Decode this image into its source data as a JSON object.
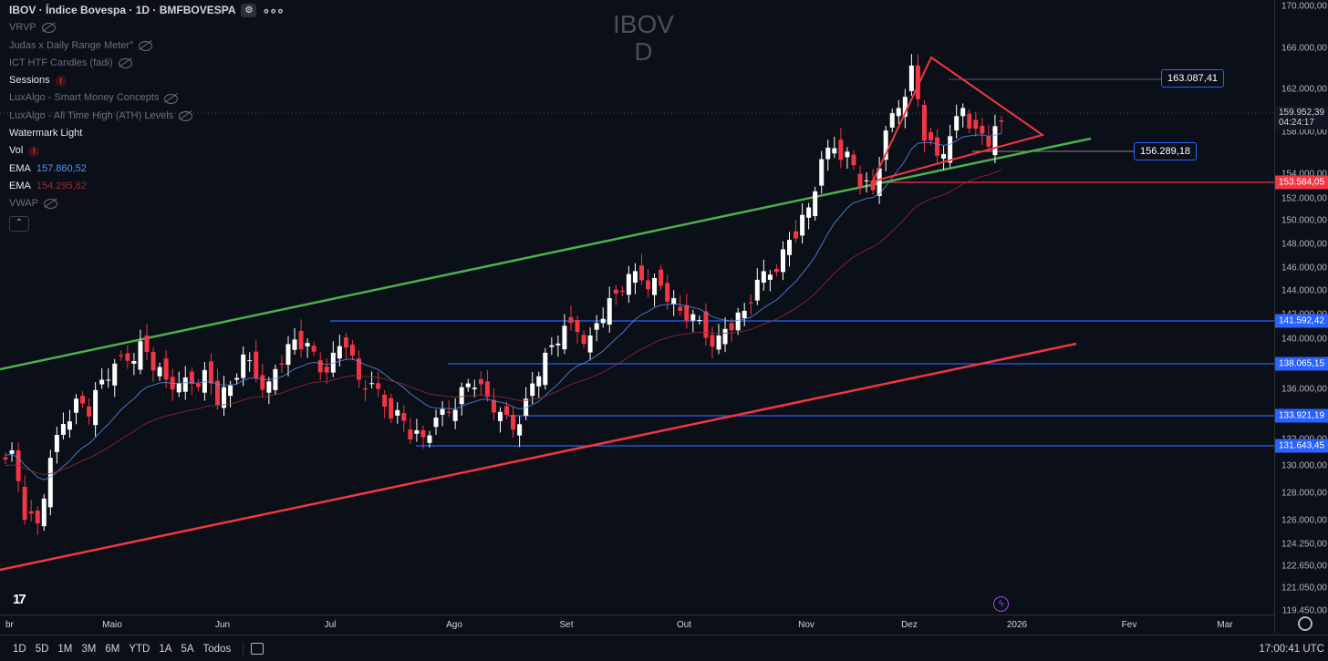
{
  "header": {
    "symbol_title": "IBOV · Índice Bovespa · 1D · BMFBOVESPA",
    "title_icon": "settings-icon",
    "more_icon": "more-dots-icon"
  },
  "indicators": [
    {
      "name": "VRVP",
      "value": "",
      "hidden": true
    },
    {
      "name": "Judas x Daily Range Meter°",
      "value": "",
      "hidden": true
    },
    {
      "name": "ICT HTF Candles (fadi)",
      "value": "",
      "hidden": true
    },
    {
      "name": "Sessions",
      "value": "",
      "hidden": false,
      "warning": true
    },
    {
      "name": "LuxAlgo - Smart Money Concepts",
      "value": "",
      "hidden": true
    },
    {
      "name": "LuxAlgo - All Time High (ATH) Levels",
      "value": "",
      "hidden": true
    },
    {
      "name": "Watermark Light",
      "value": "",
      "hidden": false
    },
    {
      "name": "Vol",
      "value": "",
      "hidden": false,
      "warning": true
    },
    {
      "name": "EMA",
      "value": "157.860,52",
      "hidden": false,
      "color": "#5b8def"
    },
    {
      "name": "EMA",
      "value": "154.295,82",
      "hidden": false,
      "color": "#9a2a35"
    },
    {
      "name": "VWAP",
      "value": "",
      "hidden": true
    }
  ],
  "watermark": {
    "line1": "IBOV",
    "line2": "D"
  },
  "price_axis": {
    "ticks": [
      "170.000,00",
      "166.000,00",
      "162.000,00",
      "158.000,00",
      "154.000,00",
      "152.000,00",
      "150.000,00",
      "148.000,00",
      "146.000,00",
      "144.000,00",
      "142.000,00",
      "140.000,00",
      "138.000,00",
      "136.000,00",
      "134.000,00",
      "132.000,00",
      "130.000,00",
      "128.000,00",
      "126.000,00",
      "124.250,00",
      "122.650,00",
      "121.050,00",
      "119.450,00"
    ],
    "current_price": "159.952,39",
    "countdown": "04:24:17",
    "levels": [
      {
        "label": "153.584,05",
        "color": "#f23645"
      },
      {
        "label": "141.592,42",
        "color": "#2962ff"
      },
      {
        "label": "138.065,15",
        "color": "#2962ff"
      },
      {
        "label": "133.921,19",
        "color": "#2962ff"
      },
      {
        "label": "131.643,45",
        "color": "#2962ff"
      }
    ]
  },
  "price_boxes": {
    "top": "163.087,41",
    "mid": "156.289,18"
  },
  "time_axis": [
    "br",
    "Maio",
    "Jun",
    "Jul",
    "Ago",
    "Set",
    "Out",
    "Nov",
    "Dez",
    "2026",
    "Fev",
    "Mar"
  ],
  "bottom_bar": {
    "ranges": [
      "1D",
      "5D",
      "1M",
      "3M",
      "6M",
      "YTD",
      "1A",
      "5A",
      "Todos"
    ],
    "clock": "17:00:41 UTC"
  },
  "tv_logo": "17",
  "collapse_icon": "chevron-up-icon",
  "chart_data": {
    "type": "candlestick",
    "series_anchor_closes": [
      131.0,
      126.0,
      125.0,
      130.0,
      134.0,
      135.5,
      135.0,
      137.5,
      138.2,
      139.5,
      140.5,
      139.0,
      137.5,
      136.5,
      137.5,
      138.0,
      136.0,
      137.0,
      139.0,
      138.0,
      137.0,
      139.5,
      141.0,
      140.0,
      138.5,
      139.5,
      141.0,
      137.5,
      136.5,
      135.5,
      134.5,
      133.0,
      132.5,
      133.5,
      135.0,
      136.5,
      137.5,
      136.0,
      134.0,
      133.5,
      135.5,
      138.5,
      140.5,
      141.5,
      142.0,
      141.0,
      143.5,
      145.0,
      146.0,
      146.5,
      146.0,
      145.0,
      143.5,
      142.5,
      141.5,
      141.0,
      142.5,
      143.5,
      145.5,
      147.0,
      148.5,
      150.5,
      152.5,
      156.0,
      158.0,
      157.0,
      155.0,
      154.0,
      158.5,
      161.5,
      164.5,
      159.0,
      157.0,
      158.0,
      161.5,
      159.0,
      158.5,
      159.95
    ],
    "trendlines": [
      {
        "color": "#4caf50",
        "from": [
          0,
          141.5
        ],
        "to": [
          1196,
          158.3
        ]
      },
      {
        "color": "#f23645",
        "from": [
          0,
          123.0
        ],
        "to": [
          1180,
          140.0
        ]
      }
    ]
  },
  "colors": {
    "up": "#ffffff",
    "down": "#f23645",
    "support": "#2962ff",
    "resistance": "#f23645",
    "channel_top": "#4caf50",
    "ema_fast": "#5b8def",
    "ema_slow": "#9a2a35",
    "background": "#0b0f17"
  }
}
